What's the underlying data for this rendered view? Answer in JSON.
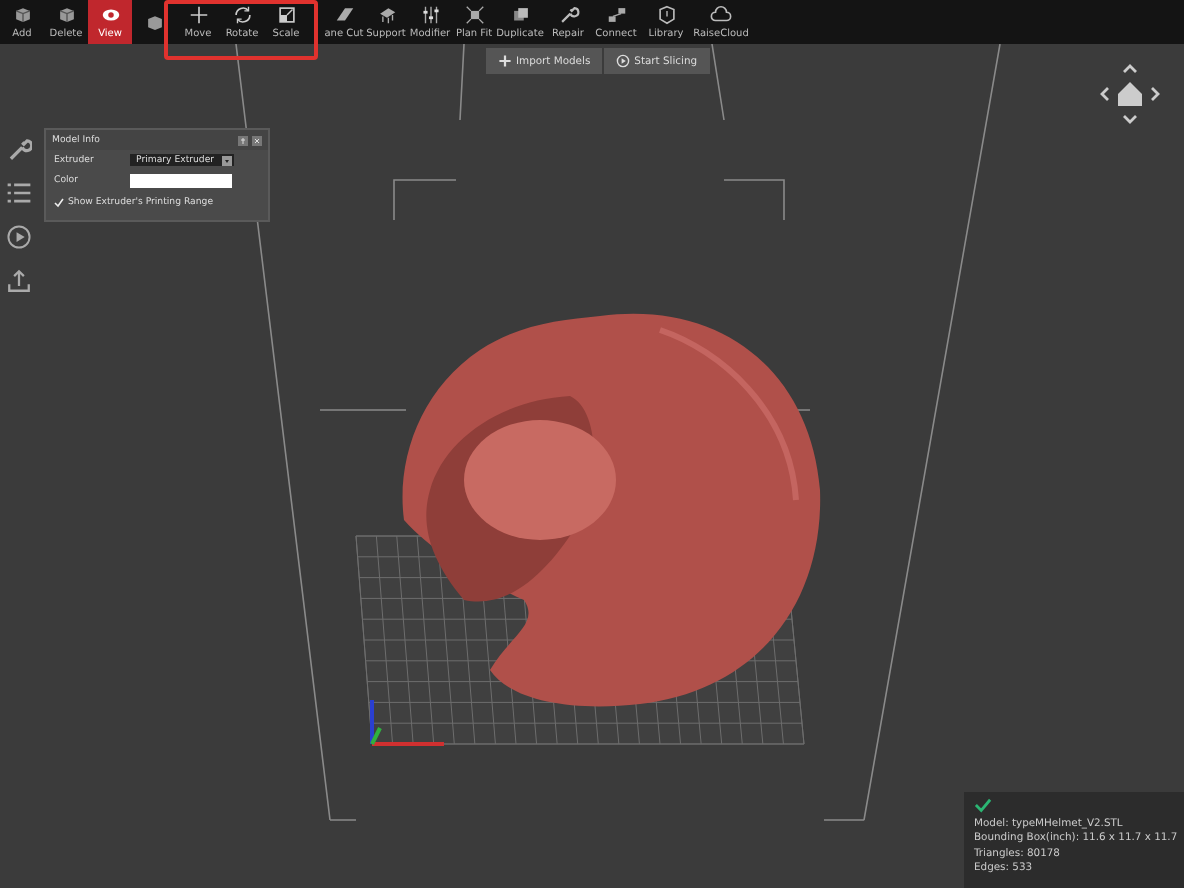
{
  "toolbar": [
    {
      "label": "Add",
      "selected": false
    },
    {
      "label": "Delete",
      "selected": false
    },
    {
      "label": "View",
      "selected": true
    },
    {
      "selected": false
    },
    {
      "label": "Move",
      "selected": false
    },
    {
      "label": "Rotate",
      "selected": false
    },
    {
      "label": "Scale",
      "selected": false
    },
    {
      "label": "ane Cut",
      "selected": false
    },
    {
      "label": "Support",
      "selected": false
    },
    {
      "label": "Modifier",
      "selected": false
    },
    {
      "label": "Plan Fit",
      "selected": false
    },
    {
      "label": "Duplicate",
      "selected": false
    },
    {
      "label": "Repair",
      "selected": false
    },
    {
      "label": "Connect",
      "selected": false
    },
    {
      "label": "Library",
      "selected": false
    },
    {
      "label": "RaiseCloud",
      "selected": false
    }
  ],
  "actions": [
    "Import Models",
    "Start Slicing"
  ],
  "model_info": {
    "title": "Model Info",
    "extruder": {
      "label": "Extruder",
      "value": "Primary Extruder"
    },
    "color": {
      "label": "Color"
    },
    "show_range": {
      "label": "Show Extruder's Printing Range",
      "checked": true
    }
  },
  "model_stats": [
    "Model: typeMHelmet_V2.STL",
    "Bounding Box(inch): 11.6 x 11.7 x 11.7",
    "Triangles: 80178",
    "Edges: 533"
  ]
}
